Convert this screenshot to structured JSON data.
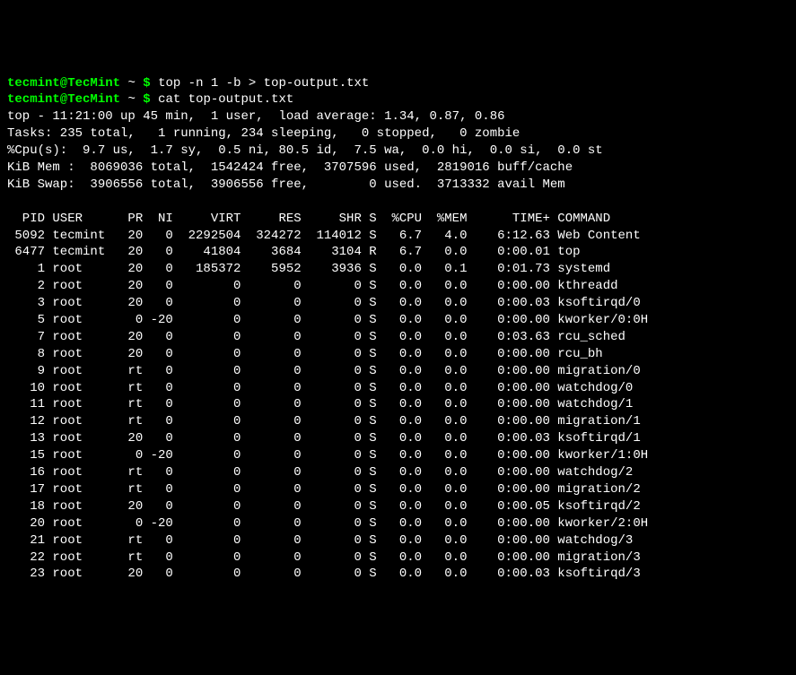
{
  "prompt": {
    "userhost": "tecmint@TecMint",
    "tilde": "~",
    "dollar": "$",
    "cmd1": "top -n 1 -b > top-output.txt",
    "cmd2": "cat top-output.txt"
  },
  "summary": {
    "line1": "top - 11:21:00 up 45 min,  1 user,  load average: 1.34, 0.87, 0.86",
    "line2": "Tasks: 235 total,   1 running, 234 sleeping,   0 stopped,   0 zombie",
    "line3": "%Cpu(s):  9.7 us,  1.7 sy,  0.5 ni, 80.5 id,  7.5 wa,  0.0 hi,  0.0 si,  0.0 st",
    "line4": "KiB Mem :  8069036 total,  1542424 free,  3707596 used,  2819016 buff/cache",
    "line5": "KiB Swap:  3906556 total,  3906556 free,        0 used.  3713332 avail Mem"
  },
  "header": {
    "pid": "PID",
    "user": "USER",
    "pr": "PR",
    "ni": "NI",
    "virt": "VIRT",
    "res": "RES",
    "shr": "SHR",
    "s": "S",
    "cpu": "%CPU",
    "mem": "%MEM",
    "time": "TIME+",
    "command": "COMMAND"
  },
  "rows": [
    {
      "pid": "5092",
      "user": "tecmint",
      "pr": "20",
      "ni": "0",
      "virt": "2292504",
      "res": "324272",
      "shr": "114012",
      "s": "S",
      "cpu": "6.7",
      "mem": "4.0",
      "time": "6:12.63",
      "command": "Web Content"
    },
    {
      "pid": "6477",
      "user": "tecmint",
      "pr": "20",
      "ni": "0",
      "virt": "41804",
      "res": "3684",
      "shr": "3104",
      "s": "R",
      "cpu": "6.7",
      "mem": "0.0",
      "time": "0:00.01",
      "command": "top"
    },
    {
      "pid": "1",
      "user": "root",
      "pr": "20",
      "ni": "0",
      "virt": "185372",
      "res": "5952",
      "shr": "3936",
      "s": "S",
      "cpu": "0.0",
      "mem": "0.1",
      "time": "0:01.73",
      "command": "systemd"
    },
    {
      "pid": "2",
      "user": "root",
      "pr": "20",
      "ni": "0",
      "virt": "0",
      "res": "0",
      "shr": "0",
      "s": "S",
      "cpu": "0.0",
      "mem": "0.0",
      "time": "0:00.00",
      "command": "kthreadd"
    },
    {
      "pid": "3",
      "user": "root",
      "pr": "20",
      "ni": "0",
      "virt": "0",
      "res": "0",
      "shr": "0",
      "s": "S",
      "cpu": "0.0",
      "mem": "0.0",
      "time": "0:00.03",
      "command": "ksoftirqd/0"
    },
    {
      "pid": "5",
      "user": "root",
      "pr": "0",
      "ni": "-20",
      "virt": "0",
      "res": "0",
      "shr": "0",
      "s": "S",
      "cpu": "0.0",
      "mem": "0.0",
      "time": "0:00.00",
      "command": "kworker/0:0H"
    },
    {
      "pid": "7",
      "user": "root",
      "pr": "20",
      "ni": "0",
      "virt": "0",
      "res": "0",
      "shr": "0",
      "s": "S",
      "cpu": "0.0",
      "mem": "0.0",
      "time": "0:03.63",
      "command": "rcu_sched"
    },
    {
      "pid": "8",
      "user": "root",
      "pr": "20",
      "ni": "0",
      "virt": "0",
      "res": "0",
      "shr": "0",
      "s": "S",
      "cpu": "0.0",
      "mem": "0.0",
      "time": "0:00.00",
      "command": "rcu_bh"
    },
    {
      "pid": "9",
      "user": "root",
      "pr": "rt",
      "ni": "0",
      "virt": "0",
      "res": "0",
      "shr": "0",
      "s": "S",
      "cpu": "0.0",
      "mem": "0.0",
      "time": "0:00.00",
      "command": "migration/0"
    },
    {
      "pid": "10",
      "user": "root",
      "pr": "rt",
      "ni": "0",
      "virt": "0",
      "res": "0",
      "shr": "0",
      "s": "S",
      "cpu": "0.0",
      "mem": "0.0",
      "time": "0:00.00",
      "command": "watchdog/0"
    },
    {
      "pid": "11",
      "user": "root",
      "pr": "rt",
      "ni": "0",
      "virt": "0",
      "res": "0",
      "shr": "0",
      "s": "S",
      "cpu": "0.0",
      "mem": "0.0",
      "time": "0:00.00",
      "command": "watchdog/1"
    },
    {
      "pid": "12",
      "user": "root",
      "pr": "rt",
      "ni": "0",
      "virt": "0",
      "res": "0",
      "shr": "0",
      "s": "S",
      "cpu": "0.0",
      "mem": "0.0",
      "time": "0:00.00",
      "command": "migration/1"
    },
    {
      "pid": "13",
      "user": "root",
      "pr": "20",
      "ni": "0",
      "virt": "0",
      "res": "0",
      "shr": "0",
      "s": "S",
      "cpu": "0.0",
      "mem": "0.0",
      "time": "0:00.03",
      "command": "ksoftirqd/1"
    },
    {
      "pid": "15",
      "user": "root",
      "pr": "0",
      "ni": "-20",
      "virt": "0",
      "res": "0",
      "shr": "0",
      "s": "S",
      "cpu": "0.0",
      "mem": "0.0",
      "time": "0:00.00",
      "command": "kworker/1:0H"
    },
    {
      "pid": "16",
      "user": "root",
      "pr": "rt",
      "ni": "0",
      "virt": "0",
      "res": "0",
      "shr": "0",
      "s": "S",
      "cpu": "0.0",
      "mem": "0.0",
      "time": "0:00.00",
      "command": "watchdog/2"
    },
    {
      "pid": "17",
      "user": "root",
      "pr": "rt",
      "ni": "0",
      "virt": "0",
      "res": "0",
      "shr": "0",
      "s": "S",
      "cpu": "0.0",
      "mem": "0.0",
      "time": "0:00.00",
      "command": "migration/2"
    },
    {
      "pid": "18",
      "user": "root",
      "pr": "20",
      "ni": "0",
      "virt": "0",
      "res": "0",
      "shr": "0",
      "s": "S",
      "cpu": "0.0",
      "mem": "0.0",
      "time": "0:00.05",
      "command": "ksoftirqd/2"
    },
    {
      "pid": "20",
      "user": "root",
      "pr": "0",
      "ni": "-20",
      "virt": "0",
      "res": "0",
      "shr": "0",
      "s": "S",
      "cpu": "0.0",
      "mem": "0.0",
      "time": "0:00.00",
      "command": "kworker/2:0H"
    },
    {
      "pid": "21",
      "user": "root",
      "pr": "rt",
      "ni": "0",
      "virt": "0",
      "res": "0",
      "shr": "0",
      "s": "S",
      "cpu": "0.0",
      "mem": "0.0",
      "time": "0:00.00",
      "command": "watchdog/3"
    },
    {
      "pid": "22",
      "user": "root",
      "pr": "rt",
      "ni": "0",
      "virt": "0",
      "res": "0",
      "shr": "0",
      "s": "S",
      "cpu": "0.0",
      "mem": "0.0",
      "time": "0:00.00",
      "command": "migration/3"
    },
    {
      "pid": "23",
      "user": "root",
      "pr": "20",
      "ni": "0",
      "virt": "0",
      "res": "0",
      "shr": "0",
      "s": "S",
      "cpu": "0.0",
      "mem": "0.0",
      "time": "0:00.03",
      "command": "ksoftirqd/3"
    }
  ]
}
